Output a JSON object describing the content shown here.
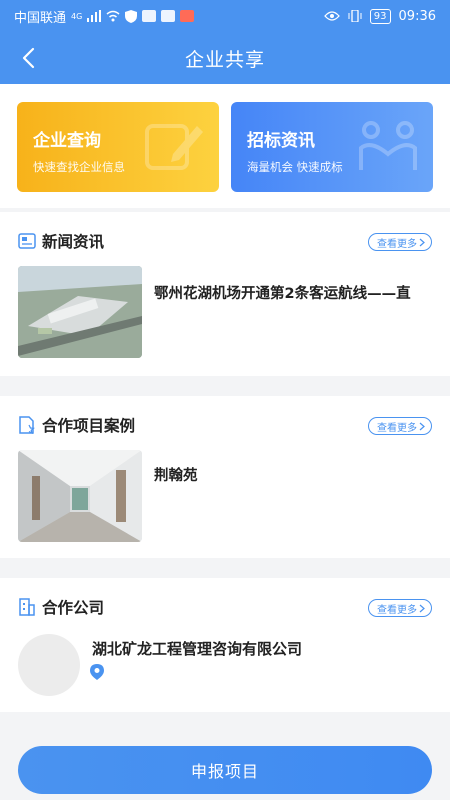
{
  "status_bar": {
    "carrier": "中国联通",
    "network": "4G",
    "battery": "93",
    "time": "09:36"
  },
  "nav": {
    "title": "企业共享"
  },
  "cards": [
    {
      "title": "企业查询",
      "subtitle": "快速查找企业信息"
    },
    {
      "title": "招标资讯",
      "subtitle": "海量机会 快速成标"
    }
  ],
  "news": {
    "title": "新闻资讯",
    "more": "查看更多",
    "items": [
      {
        "title": "鄂州花湖机场开通第2条客运航线——直"
      }
    ]
  },
  "cases": {
    "title": "合作项目案例",
    "more": "查看更多",
    "items": [
      {
        "title": "荆翰苑"
      }
    ]
  },
  "companies": {
    "title": "合作公司",
    "more": "查看更多",
    "items": [
      {
        "name": "湖北矿龙工程管理咨询有限公司"
      }
    ]
  },
  "footer": {
    "submit_label": "申报项目"
  }
}
